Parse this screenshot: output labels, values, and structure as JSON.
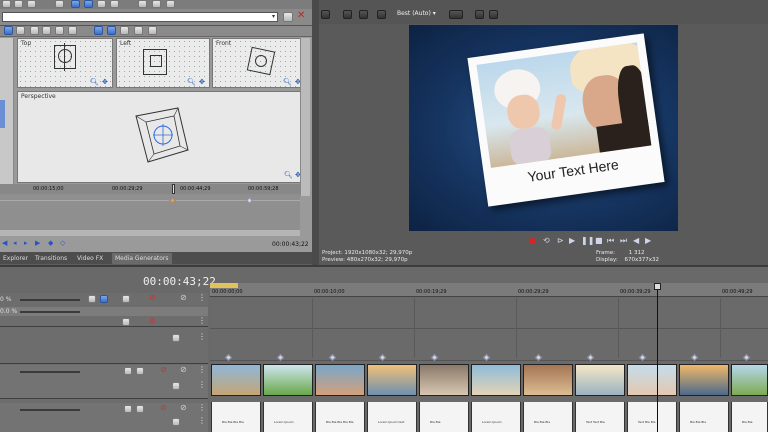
{
  "pan_crop": {
    "views": {
      "top": "Top",
      "left": "Left",
      "front": "Front",
      "perspective": "Perspective"
    },
    "ruler": [
      "00:00:15;00",
      "00:00:29;29",
      "00:00:44;29",
      "00:00:59;28"
    ],
    "time": "00:00:43;22"
  },
  "tabs": [
    "Explorer",
    "Transitions",
    "Video FX",
    "Media Generators"
  ],
  "preview": {
    "quality": "Best (Auto)",
    "overlay_text": "Your Text Here",
    "project_label": "Project:",
    "project_value": "1920x1080x32; 29,970p",
    "preview_label": "Preview:",
    "preview_value": "480x270x32; 29,970p",
    "frame_label": "Frame:",
    "frame_value": "1 312",
    "display_label": "Display:",
    "display_value": "670x377x32"
  },
  "timeline": {
    "timecode": "00:00:43;22",
    "ruler": [
      "00:00:00;00",
      "00:00:10;00",
      "00:00:19;29",
      "00:00:29;29",
      "00:00:39;29",
      "00:00:49;29"
    ],
    "track_levels": [
      "0 %",
      "0.0 %"
    ],
    "clip_titles": [
      "Bla Bla Bla Bla",
      "Lorem Ipsum",
      "Bla Bla Bla Bla Bla",
      "Lorem Ipsum text",
      "Bla Bla",
      "Lorem Ipsum",
      "Bla Bla Bla",
      "Text Text Bla",
      "Text Bla Bla",
      "Bla Bla Bla",
      "Bla Bla"
    ]
  }
}
